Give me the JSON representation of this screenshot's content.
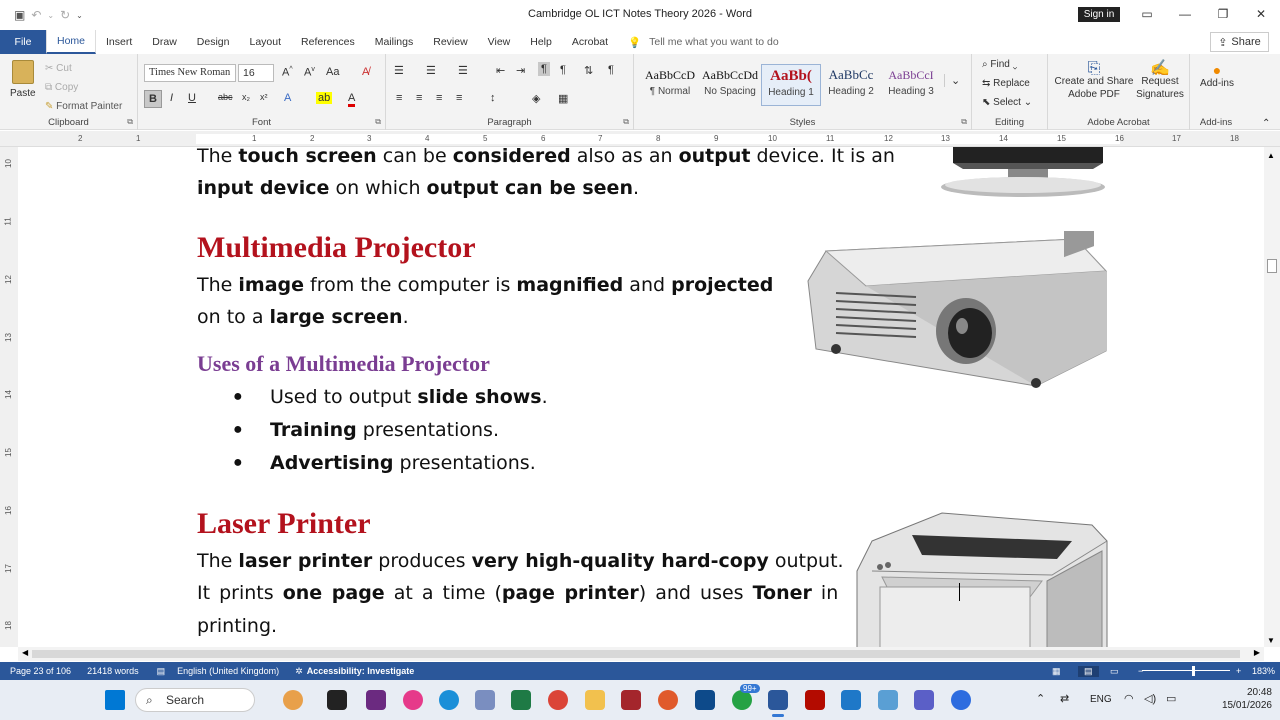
{
  "window": {
    "title": "Cambridge OL ICT Notes Theory 2026  -  Word",
    "signin": "Sign in"
  },
  "tabs": [
    "Home",
    "Insert",
    "Draw",
    "Design",
    "Layout",
    "References",
    "Mailings",
    "Review",
    "View",
    "Help",
    "Acrobat"
  ],
  "file_tab": "File",
  "tellme": "Tell me what you want to do",
  "share": "Share",
  "clipboard": {
    "paste": "Paste",
    "cut": "Cut",
    "copy": "Copy",
    "format_painter": "Format Painter",
    "label": "Clipboard"
  },
  "font": {
    "family": "Times New Roman",
    "size": "16",
    "label": "Font"
  },
  "paragraph": {
    "label": "Paragraph"
  },
  "styles": {
    "label": "Styles",
    "items": [
      {
        "preview": "AaBbCcD",
        "name": "¶ Normal"
      },
      {
        "preview": "AaBbCcDd",
        "name": "No Spacing"
      },
      {
        "preview": "AaBb(",
        "name": "Heading 1"
      },
      {
        "preview": "AaBbCc",
        "name": "Heading 2"
      },
      {
        "preview": "AaBbCcI",
        "name": "Heading 3"
      }
    ]
  },
  "editing": {
    "find": "Find",
    "replace": "Replace",
    "select": "Select",
    "label": "Editing"
  },
  "acrobat": {
    "create": "Create and Share Adobe PDF",
    "request": "Request Signatures",
    "label": "Adobe Acrobat"
  },
  "addins": {
    "button": "Add-ins",
    "label": "Add-ins"
  },
  "ruler_numbers": [
    "2",
    "1",
    "1",
    "2",
    "3",
    "4",
    "5",
    "6",
    "7",
    "8",
    "9",
    "10",
    "11",
    "12",
    "13",
    "14",
    "15",
    "16",
    "17",
    "18"
  ],
  "vruler_numbers": [
    "10",
    "11",
    "12",
    "13",
    "14",
    "15",
    "16",
    "17",
    "18"
  ],
  "document": {
    "line1_parts": [
      "The ",
      "touch screen",
      " can be ",
      "considered",
      " also as an ",
      "output",
      " device. It is an"
    ],
    "line2_parts": [
      "input device",
      " on which ",
      "output can be seen",
      "."
    ],
    "heading_projector": "Multimedia Projector",
    "proj_line1": [
      "The ",
      "image",
      " from the computer is ",
      "magnified",
      " and ",
      "projected"
    ],
    "proj_line2": [
      "on to a ",
      "large screen",
      "."
    ],
    "uses_heading": "Uses of a Multimedia Projector",
    "bullets": [
      [
        "Used to output ",
        "slide shows",
        "."
      ],
      [
        "Training",
        " presentations."
      ],
      [
        "Advertising",
        " presentations."
      ]
    ],
    "heading_printer": "Laser Printer",
    "printer_line1": [
      "The ",
      "laser printer",
      " produces ",
      "very high-quality hard-copy",
      " output."
    ],
    "printer_line2": [
      "It prints ",
      "one page",
      " at a time (",
      "page printer",
      ") and uses ",
      "Toner",
      " in"
    ],
    "printer_line3": "printing."
  },
  "status": {
    "page": "Page 23 of 106",
    "words": "21418 words",
    "language": "English (United Kingdom)",
    "accessibility": "Accessibility: Investigate",
    "zoom": "183%"
  },
  "taskbar": {
    "search": "Search",
    "badge": "99+",
    "lang": "ENG",
    "time": "20:48",
    "date": "15/01/2026"
  }
}
